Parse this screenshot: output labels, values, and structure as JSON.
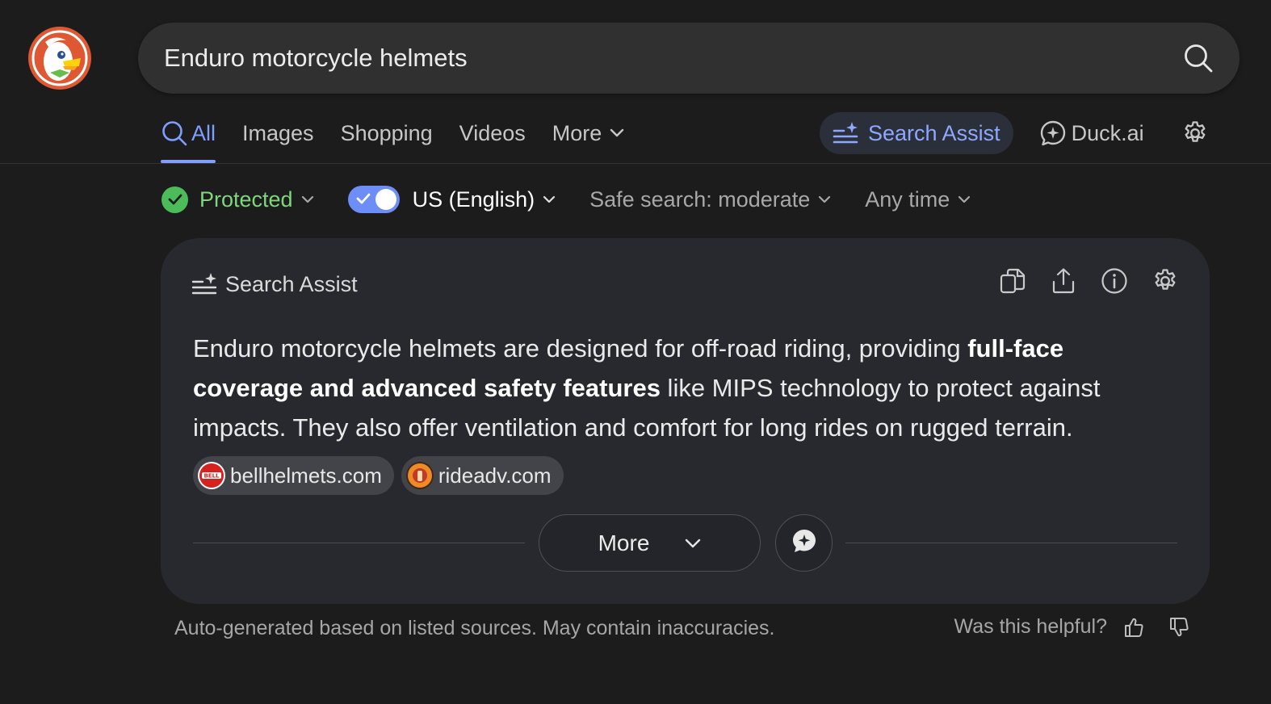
{
  "search": {
    "query": "Enduro motorcycle helmets"
  },
  "tabs": [
    {
      "label": "All",
      "icon": "search-icon",
      "active": true
    },
    {
      "label": "Images"
    },
    {
      "label": "Shopping"
    },
    {
      "label": "Videos"
    },
    {
      "label": "More",
      "icon": "chevron-down-icon"
    }
  ],
  "nav_right": {
    "search_assist": "Search Assist",
    "duck_ai": "Duck.ai"
  },
  "filters": {
    "protected": "Protected",
    "region": "US (English)",
    "safe_search": "Safe search: moderate",
    "time": "Any time"
  },
  "assist": {
    "title": "Search Assist",
    "answer": {
      "part1": "Enduro motorcycle helmets are designed for off-road riding, providing ",
      "bold": "full-face coverage and advanced safety features",
      "part2": " like MIPS technology to protect against impacts. They also offer ventilation and comfort for long rides on rugged terrain."
    },
    "sources": [
      {
        "label": "bellhelmets.com",
        "favicon_text": "BELL"
      },
      {
        "label": "rideadv.com"
      }
    ],
    "more_label": "More"
  },
  "footer": {
    "note": "Auto-generated based on listed sources. May contain inaccuracies.",
    "helpful": "Was this helpful?"
  },
  "colors": {
    "background": "#1c1c1c",
    "accent": "#7f9eff",
    "protected_green": "#4cbb5a",
    "card": "#28292e",
    "logo_orange": "#de5833"
  }
}
